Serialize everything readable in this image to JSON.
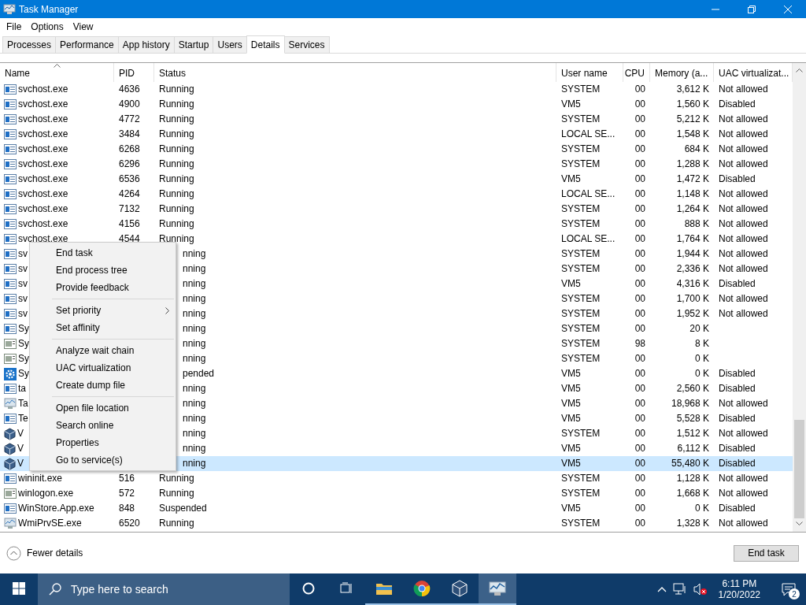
{
  "window": {
    "title": "Task Manager"
  },
  "menu_bar": [
    "File",
    "Options",
    "View"
  ],
  "tabs": [
    {
      "label": "Processes",
      "selected": false
    },
    {
      "label": "Performance",
      "selected": false
    },
    {
      "label": "App history",
      "selected": false
    },
    {
      "label": "Startup",
      "selected": false
    },
    {
      "label": "Users",
      "selected": false
    },
    {
      "label": "Details",
      "selected": true
    },
    {
      "label": "Services",
      "selected": false
    }
  ],
  "table": {
    "columns": [
      "Name",
      "PID",
      "Status",
      "User name",
      "CPU",
      "Memory (a...",
      "UAC virtualizat..."
    ],
    "rows": [
      {
        "kind": "service",
        "name": "svchost.exe",
        "pid": "4636",
        "status": "Running",
        "user": "SYSTEM",
        "cpu": "00",
        "memory": "3,612 K",
        "uac": "Not allowed",
        "selected": false
      },
      {
        "kind": "service",
        "name": "svchost.exe",
        "pid": "4900",
        "status": "Running",
        "user": "VM5",
        "cpu": "00",
        "memory": "1,560 K",
        "uac": "Disabled",
        "selected": false
      },
      {
        "kind": "service",
        "name": "svchost.exe",
        "pid": "4772",
        "status": "Running",
        "user": "SYSTEM",
        "cpu": "00",
        "memory": "5,212 K",
        "uac": "Not allowed",
        "selected": false
      },
      {
        "kind": "service",
        "name": "svchost.exe",
        "pid": "3484",
        "status": "Running",
        "user": "LOCAL SE...",
        "cpu": "00",
        "memory": "1,548 K",
        "uac": "Not allowed",
        "selected": false
      },
      {
        "kind": "service",
        "name": "svchost.exe",
        "pid": "6268",
        "status": "Running",
        "user": "SYSTEM",
        "cpu": "00",
        "memory": "684 K",
        "uac": "Not allowed",
        "selected": false
      },
      {
        "kind": "service",
        "name": "svchost.exe",
        "pid": "6296",
        "status": "Running",
        "user": "SYSTEM",
        "cpu": "00",
        "memory": "1,288 K",
        "uac": "Not allowed",
        "selected": false
      },
      {
        "kind": "service",
        "name": "svchost.exe",
        "pid": "6536",
        "status": "Running",
        "user": "VM5",
        "cpu": "00",
        "memory": "1,472 K",
        "uac": "Disabled",
        "selected": false
      },
      {
        "kind": "service",
        "name": "svchost.exe",
        "pid": "4264",
        "status": "Running",
        "user": "LOCAL SE...",
        "cpu": "00",
        "memory": "1,148 K",
        "uac": "Not allowed",
        "selected": false
      },
      {
        "kind": "service",
        "name": "svchost.exe",
        "pid": "7132",
        "status": "Running",
        "user": "SYSTEM",
        "cpu": "00",
        "memory": "1,264 K",
        "uac": "Not allowed",
        "selected": false
      },
      {
        "kind": "service",
        "name": "svchost.exe",
        "pid": "4156",
        "status": "Running",
        "user": "SYSTEM",
        "cpu": "00",
        "memory": "888 K",
        "uac": "Not allowed",
        "selected": false
      },
      {
        "kind": "service",
        "name": "svchost.exe",
        "pid": "4544",
        "status": "Running",
        "user": "LOCAL SE...",
        "cpu": "00",
        "memory": "1,764 K",
        "uac": "Not allowed",
        "selected": false
      },
      {
        "kind": "service",
        "name": "sv",
        "status": "nning",
        "user": "SYSTEM",
        "cpu": "00",
        "memory": "1,944 K",
        "uac": "Not allowed",
        "selected": false
      },
      {
        "kind": "service",
        "name": "sv",
        "status": "nning",
        "user": "SYSTEM",
        "cpu": "00",
        "memory": "2,336 K",
        "uac": "Not allowed",
        "selected": false
      },
      {
        "kind": "service",
        "name": "sv",
        "status": "nning",
        "user": "VM5",
        "cpu": "00",
        "memory": "4,316 K",
        "uac": "Disabled",
        "selected": false
      },
      {
        "kind": "service",
        "name": "sv",
        "status": "nning",
        "user": "SYSTEM",
        "cpu": "00",
        "memory": "1,700 K",
        "uac": "Not allowed",
        "selected": false
      },
      {
        "kind": "service",
        "name": "sv",
        "status": "nning",
        "user": "SYSTEM",
        "cpu": "00",
        "memory": "1,952 K",
        "uac": "Not allowed",
        "selected": false
      },
      {
        "kind": "service",
        "name": "Sy",
        "status": "nning",
        "user": "SYSTEM",
        "cpu": "00",
        "memory": "20 K",
        "selected": false
      },
      {
        "kind": "window",
        "name": "Sy",
        "status": "nning",
        "user": "SYSTEM",
        "cpu": "98",
        "memory": "8 K",
        "selected": false
      },
      {
        "kind": "window",
        "name": "Sy",
        "status": "nning",
        "user": "SYSTEM",
        "cpu": "00",
        "memory": "0 K",
        "selected": false
      },
      {
        "kind": "gear",
        "name": "Sy",
        "status": "pended",
        "user": "VM5",
        "cpu": "00",
        "memory": "0 K",
        "uac": "Disabled",
        "selected": false
      },
      {
        "kind": "service",
        "name": "ta",
        "status": "nning",
        "user": "VM5",
        "cpu": "00",
        "memory": "2,560 K",
        "uac": "Disabled",
        "selected": false
      },
      {
        "kind": "monitor",
        "name": "Ta",
        "status": "nning",
        "user": "VM5",
        "cpu": "00",
        "memory": "18,968 K",
        "uac": "Not allowed",
        "selected": false
      },
      {
        "kind": "service",
        "name": "Te",
        "status": "nning",
        "user": "VM5",
        "cpu": "00",
        "memory": "5,528 K",
        "uac": "Disabled",
        "selected": false
      },
      {
        "kind": "cube",
        "name": "V",
        "status": "nning",
        "user": "SYSTEM",
        "cpu": "00",
        "memory": "1,512 K",
        "uac": "Not allowed",
        "selected": false
      },
      {
        "kind": "cube",
        "name": "V",
        "status": "nning",
        "user": "VM5",
        "cpu": "00",
        "memory": "6,112 K",
        "uac": "Disabled",
        "selected": false
      },
      {
        "kind": "cube",
        "name": "V",
        "status": "nning",
        "user": "VM5",
        "cpu": "00",
        "memory": "55,480 K",
        "uac": "Disabled",
        "selected": true
      },
      {
        "kind": "service",
        "name": "wininit.exe",
        "pid": "516",
        "status": "Running",
        "user": "SYSTEM",
        "cpu": "00",
        "memory": "1,128 K",
        "uac": "Not allowed",
        "selected": false
      },
      {
        "kind": "window",
        "name": "winlogon.exe",
        "pid": "572",
        "status": "Running",
        "user": "SYSTEM",
        "cpu": "00",
        "memory": "1,668 K",
        "uac": "Not allowed",
        "selected": false
      },
      {
        "kind": "service",
        "name": "WinStore.App.exe",
        "pid": "848",
        "status": "Suspended",
        "user": "VM5",
        "cpu": "00",
        "memory": "0 K",
        "uac": "Disabled",
        "selected": false
      },
      {
        "kind": "monitor",
        "name": "WmiPrvSE.exe",
        "pid": "6520",
        "status": "Running",
        "user": "SYSTEM",
        "cpu": "00",
        "memory": "1,328 K",
        "uac": "Not allowed",
        "selected": false
      }
    ]
  },
  "context_menu": {
    "groups": [
      [
        {
          "label": "End task",
          "submenu": false
        },
        {
          "label": "End process tree",
          "submenu": false
        },
        {
          "label": "Provide feedback",
          "submenu": false
        }
      ],
      [
        {
          "label": "Set priority",
          "submenu": true
        },
        {
          "label": "Set affinity",
          "submenu": false
        }
      ],
      [
        {
          "label": "Analyze wait chain",
          "submenu": false
        },
        {
          "label": "UAC virtualization",
          "submenu": false
        },
        {
          "label": "Create dump file",
          "submenu": false
        }
      ],
      [
        {
          "label": "Open file location",
          "submenu": false
        },
        {
          "label": "Search online",
          "submenu": false
        },
        {
          "label": "Properties",
          "submenu": false
        },
        {
          "label": "Go to service(s)",
          "submenu": false
        }
      ]
    ]
  },
  "footer": {
    "details_toggle": "Fewer details",
    "end_task": "End task"
  },
  "taskbar": {
    "search_placeholder": "Type here to search",
    "time": "6:11 PM",
    "date": "1/20/2022",
    "notifications": "2"
  }
}
